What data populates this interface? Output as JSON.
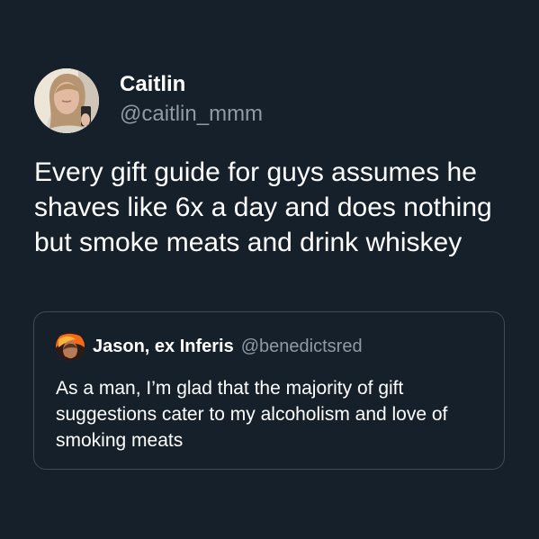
{
  "tweet": {
    "author_name": "Caitlin",
    "author_handle": "@caitlin_mmm",
    "text": "Every gift guide for guys assumes he shaves like 6x a day and does nothing but smoke meats and drink whiskey"
  },
  "quote": {
    "author_name": "Jason, ex Inferis",
    "author_handle": "@benedictsred",
    "text": "As a man, I’m glad that the majority of gift suggestions cater to my alcoholism and love of smoking meats"
  },
  "icons": {
    "author_avatar": "avatar-photo",
    "quote_avatar": "avatar-photo"
  },
  "colors": {
    "background": "#16202b",
    "primary_text": "#ffffff",
    "secondary_text": "#8f9aa5",
    "quote_border": "#3e4a56"
  }
}
